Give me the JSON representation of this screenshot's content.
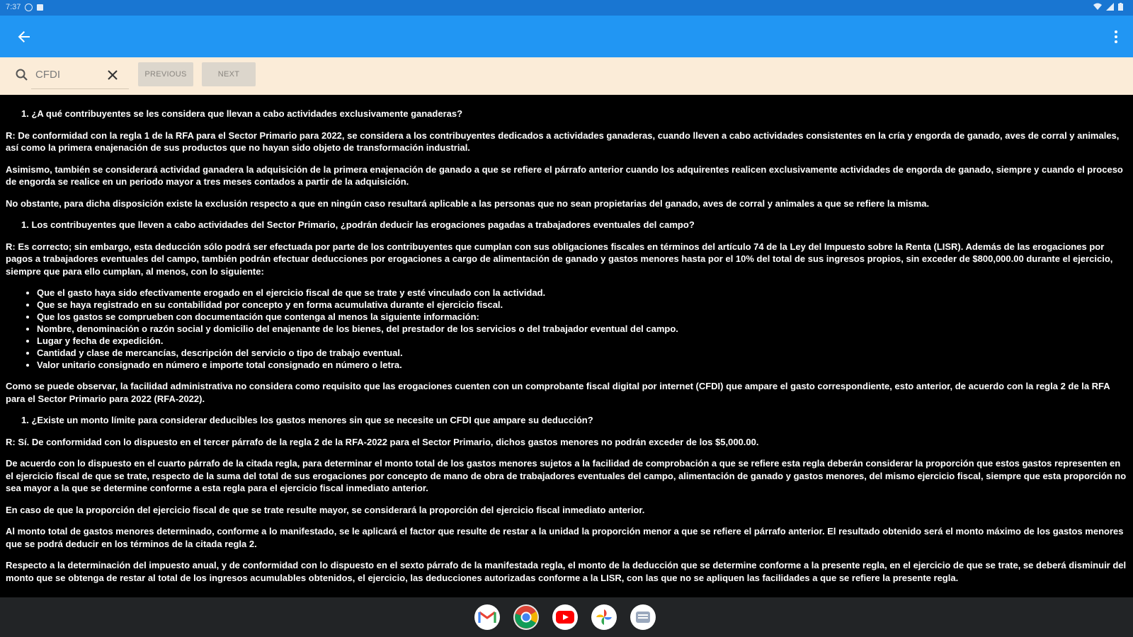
{
  "status_bar": {
    "time": "7:37"
  },
  "find_bar": {
    "query": "CFDI",
    "previous_label": "PREVIOUS",
    "next_label": "NEXT"
  },
  "article": {
    "q1": "1. ¿A qué contribuyentes se les considera que llevan a cabo actividades exclusivamente ganaderas?",
    "p1": "R: De conformidad con la regla 1 de la RFA para el Sector Primario para 2022, se considera a los contribuyentes dedicados a actividades ganaderas, cuando lleven a cabo actividades consistentes en la cría y engorda de ganado, aves de corral y animales, así como la primera enajenación de sus productos que no hayan sido objeto de transformación industrial.",
    "p2": "Asimismo, también se considerará actividad ganadera la adquisición de la primera enajenación de ganado a que se refiere el párrafo anterior cuando los adquirentes realicen exclusivamente actividades de engorda de ganado, siempre y cuando el proceso de engorda se realice en un periodo mayor a tres meses contados a partir de la adquisición.",
    "p3": "No obstante, para dicha disposición existe la exclusión respecto a que en ningún caso resultará aplicable a las personas que no sean propietarias del ganado, aves de corral y animales a que se refiere la misma.",
    "q2": "1. Los contribuyentes que lleven a cabo actividades del Sector Primario, ¿podrán deducir las erogaciones pagadas a trabajadores eventuales del campo?",
    "p4": "R: Es correcto; sin embargo, esta deducción sólo podrá ser efectuada por parte de los contribuyentes que cumplan con sus obligaciones fiscales en términos del artículo 74 de la Ley del Impuesto sobre la Renta (LISR). Además de las erogaciones por pagos a trabajadores eventuales del campo, también podrán efectuar deducciones por erogaciones a cargo de alimentación de ganado y gastos menores hasta por el 10% del total de sus ingresos propios, sin exceder de $800,000.00 durante el ejercicio, siempre que para ello cumplan, al menos, con lo siguiente:",
    "bullets": [
      "Que el gasto haya sido efectivamente erogado en el ejercicio fiscal de que se trate y esté vinculado con la actividad.",
      "Que se haya registrado en su contabilidad por concepto y en forma acumulativa durante el ejercicio fiscal.",
      "Que los gastos se comprueben con documentación que contenga al menos la siguiente información:",
      "Nombre, denominación o razón social y domicilio del enajenante de los bienes, del prestador de los servicios o del trabajador eventual del campo.",
      "Lugar y fecha de expedición.",
      "Cantidad y clase de mercancías, descripción del servicio o tipo de trabajo eventual.",
      "Valor unitario consignado en número e importe total consignado en número o letra."
    ],
    "p5": "Como se puede observar, la facilidad administrativa no considera como requisito que las erogaciones cuenten con un comprobante fiscal digital por internet (CFDI) que ampare el gasto correspondiente, esto anterior, de acuerdo con la regla 2 de la RFA para el Sector Primario para 2022 (RFA-2022).",
    "q3": "1. ¿Existe un monto límite para considerar deducibles los gastos menores sin que se necesite un CFDI que ampare su deducción?",
    "p6": "R: Sí. De conformidad con lo dispuesto en el tercer párrafo de la regla 2 de la RFA-2022 para el Sector Primario, dichos gastos menores no podrán exceder de los $5,000.00.",
    "p7": "De acuerdo con lo dispuesto en el cuarto párrafo de la citada regla, para determinar el monto total de los gastos menores sujetos a la facilidad de comprobación a que se refiere esta regla deberán considerar la proporción que estos gastos representen en el ejercicio fiscal de que se trate, respecto de la suma del total de sus erogaciones por concepto de mano de obra de trabajadores eventuales del campo, alimentación de ganado y gastos menores, del mismo ejercicio fiscal, siempre que esta proporción no sea mayor a la que se determine conforme a esta regla para el ejercicio fiscal inmediato anterior.",
    "p8": "En caso de que la proporción del ejercicio fiscal de que se trate resulte mayor, se considerará la proporción del ejercicio fiscal inmediato anterior.",
    "p9": "Al monto total de gastos menores determinado, conforme a lo manifestado, se le aplicará el factor que resulte de restar a la unidad la proporción menor a que se refiere el párrafo anterior. El resultado obtenido será el monto máximo de los gastos menores que se podrá deducir en los términos de la citada regla 2.",
    "p10": "Respecto a la determinación del impuesto anual, y de conformidad con lo dispuesto en el sexto párrafo de la manifestada regla, el monto de la deducción que se determine conforme a la presente regla, en el ejercicio de que se trate, se deberá disminuir del monto que se obtenga de restar al total de los ingresos acumulables obtenidos, el ejercicio, las deducciones autorizadas conforme a la LISR, con las que no se apliquen las facilidades a que se refiere la presente regla."
  },
  "dock": {
    "apps": [
      "gmail-icon",
      "chrome-icon",
      "youtube-icon",
      "photos-icon",
      "messages-icon"
    ]
  }
}
